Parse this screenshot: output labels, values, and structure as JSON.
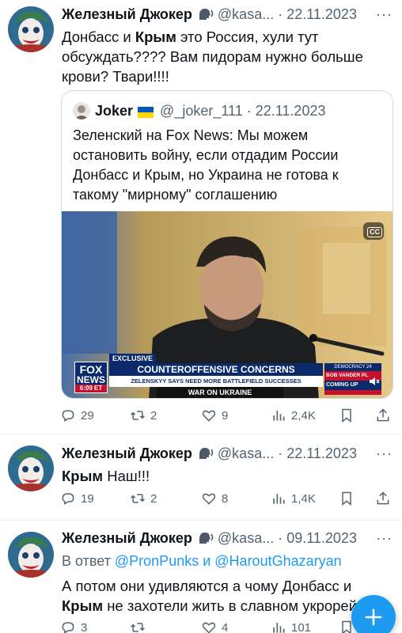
{
  "tweets": [
    {
      "author": "Железный Джокер",
      "handle": "@kasa...",
      "date": "22.11.2023",
      "more": "···",
      "text_parts": [
        "Донбасс и ",
        "Крым",
        " это Россия, хули тут обсуждать???? Вам пидорам нужно больше крови? Твари!!!!"
      ],
      "quote": {
        "author": "Joker",
        "handle": "@_joker_111",
        "date": "22.11.2023",
        "text": "Зеленский на Fox News: Мы можем остановить войну, если отдадим России Донбасс и Крым, но Украина не готова к такому \"мирному\" соглашению",
        "media": {
          "cc": "CC",
          "exclusive": "EXCLUSIVE",
          "headline": "COUNTEROFFENSIVE CONCERNS",
          "subhead": "ZELENSKYY SAYS NEED MORE BATTLEFIELD SUCCESSES",
          "ticker": "WAR ON UKRAINE",
          "logo_top": "FOX",
          "logo_bottom": "NEWS",
          "time": "6:09 ET",
          "side_label": "BOB VANDER PL",
          "coming_up": "COMING UP",
          "side_small": "DEMOCRACY 24"
        }
      },
      "stats": {
        "replies": "29",
        "retweets": "2",
        "likes": "9",
        "views": "2,4K"
      }
    },
    {
      "author": "Железный Джокер",
      "handle": "@kasa...",
      "date": "22.11.2023",
      "more": "···",
      "text_parts": [
        "Крым",
        " Наш!!!"
      ],
      "stats": {
        "replies": "19",
        "retweets": "2",
        "likes": "8",
        "views": "1,4K"
      }
    },
    {
      "author": "Железный Джокер",
      "handle": "@kasa...",
      "date": "09.11.2023",
      "more": "···",
      "reply_prefix": "В ответ ",
      "reply_user1": "@PronPunks",
      "reply_and": " и ",
      "reply_user2": "@HaroutGhazaryan",
      "text_parts": [
        "А потом они удивляются а чому Донбасс и ",
        "Крым",
        " не захотели жить в славном укрорейхе"
      ],
      "stats": {
        "replies": "3",
        "retweets": "",
        "likes": "4",
        "views": "101"
      }
    }
  ],
  "colors": {
    "accent": "#1d9bf0",
    "muted": "#536471",
    "border": "#cfd9de"
  }
}
